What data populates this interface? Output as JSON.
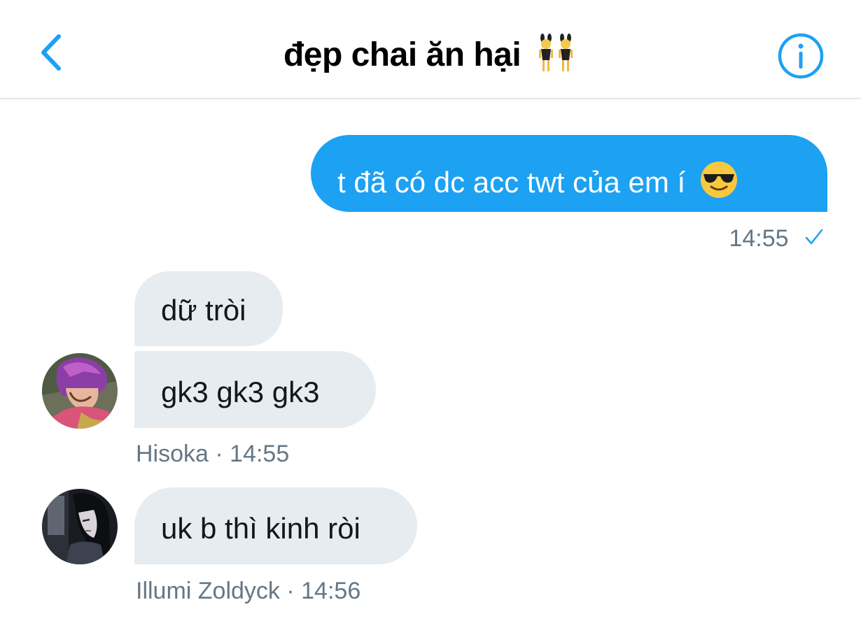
{
  "header": {
    "title": "đẹp chai ăn hại",
    "title_emoji": "women-with-bunny-ears-emoji",
    "back_icon": "chevron-left-icon",
    "info_icon": "info-circle-icon"
  },
  "messages": [
    {
      "direction": "outgoing",
      "text": "t đã có dc acc twt của em í",
      "emoji": "smiling-face-with-sunglasses-emoji",
      "time": "14:55",
      "status_icon": "check-icon"
    },
    {
      "direction": "incoming",
      "sender": "Hisoka",
      "texts": [
        "dữ tròi",
        "gk3 gk3 gk3"
      ],
      "time": "14:55",
      "meta": "Hisoka · 14:55"
    },
    {
      "direction": "incoming",
      "sender": "Illumi Zoldyck",
      "texts": [
        "uk b thì kinh ròi"
      ],
      "time": "14:56",
      "meta": "Illumi Zoldyck · 14:56"
    }
  ],
  "colors": {
    "accent": "#1da1f2",
    "incoming_bubble": "#e6ecf0",
    "meta_text": "#657786",
    "divider": "#e1e6ea"
  }
}
